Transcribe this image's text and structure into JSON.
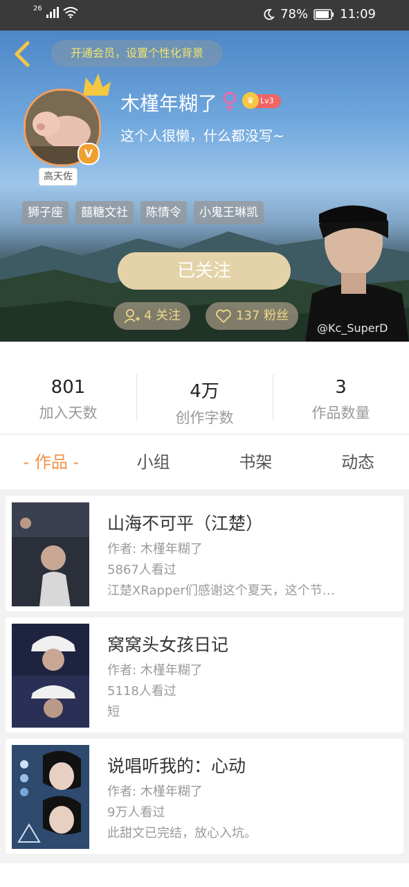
{
  "status_bar": {
    "network": "26",
    "battery": "78%",
    "time": "11:09"
  },
  "header": {
    "vip_banner": "开通会员，设置个性化背景",
    "username": "木槿年糊了",
    "level": "Lv3",
    "bio": "这个人很懒，什么都没写~",
    "avatar_tag": "高天佐",
    "tags": [
      "狮子座",
      "囍糖文社",
      "陈情令",
      "小鬼王琳凯"
    ],
    "follow_button": "已关注",
    "following": "4 关注",
    "fans": "137 粉丝",
    "watermark": "@Kc_SuperD"
  },
  "stats": [
    {
      "value": "801",
      "label": "加入天数"
    },
    {
      "value": "4万",
      "label": "创作字数"
    },
    {
      "value": "3",
      "label": "作品数量"
    }
  ],
  "tabs": [
    "- 作品 -",
    "小组",
    "书架",
    "动态"
  ],
  "works": [
    {
      "title": "山海不可平（江楚）",
      "author": "作者: 木槿年糊了",
      "views": "5867人看过",
      "desc": "江楚XRapper们感谢这个夏天，这个节…"
    },
    {
      "title": "窝窝头女孩日记",
      "author": "作者: 木槿年糊了",
      "views": "5118人看过",
      "desc": "短"
    },
    {
      "title": "说唱听我的：心动",
      "author": "作者: 木槿年糊了",
      "views": "9万人看过",
      "desc": "此甜文已完结，放心入坑。"
    }
  ],
  "colors": {
    "accent": "#f0924a",
    "follow_button": "#e4d2a8",
    "vip_text": "#f2e56b",
    "level_badge": "#f06464"
  }
}
